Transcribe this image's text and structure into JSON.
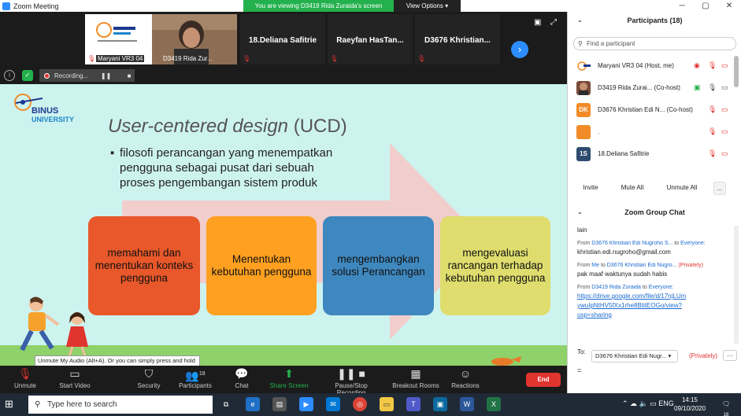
{
  "window": {
    "title": "Zoom Meeting",
    "controls": [
      "▭",
      "─",
      "▢",
      "✕"
    ]
  },
  "banner": {
    "viewing": "You are viewing D3419 Rida Zuraida's screen",
    "view_options": "View Options ▾"
  },
  "thumbnails": [
    {
      "name": "Maryani VR3 04"
    },
    {
      "name": "D3419 Rida Zur..."
    },
    {
      "name": "18.Deliana Safitrie"
    },
    {
      "name": "Raeyfan  HasTan..."
    },
    {
      "name": "D3676  Khristian..."
    }
  ],
  "recording": {
    "label": "Recording..."
  },
  "slide": {
    "logo_name": "BINUS",
    "logo_sub": "UNIVERSITY",
    "title_en": "User-centered design",
    "title_abbr": "(UCD)",
    "bullet_lines": [
      "filosofi perancangan yang menempatkan",
      "pengguna sebagai pusat dari sebuah",
      "proses pengembangan sistem produk"
    ],
    "cards": [
      {
        "text": "memahami dan menentukan konteks pengguna",
        "color": "#e8582a"
      },
      {
        "text": "Menentukan kebutuhan pengguna",
        "color": "#ffa020"
      },
      {
        "text": "mengembangkan solusi Perancangan",
        "color": "#3f88bf"
      },
      {
        "text": "mengevaluasi rancangan terhadap kebutuhan pengguna",
        "color": "#dedd6e"
      }
    ]
  },
  "tooltip": "Unmute My Audio (Alt+A). Or you can simply press and hold the space bar to temporarily unmute.",
  "toolbar": {
    "unmute": "Unmute",
    "start_video": "Start Video",
    "security": "Security",
    "participants": "Participants",
    "participants_count": "18",
    "chat": "Chat",
    "share_screen": "Share Screen",
    "pause_recording": "Pause/Stop Recording",
    "breakout_rooms": "Breakout Rooms",
    "reactions": "Reactions",
    "end": "End"
  },
  "participants_panel": {
    "title": "Participants (18)",
    "search_placeholder": "Find a participant",
    "rows": [
      {
        "initials": "",
        "name": "Maryani VR3 04 (Host, me)",
        "color": "#2d8cff"
      },
      {
        "initials": "",
        "name": "D3419 Rida Zurai... (Co-host)",
        "color": "#7a4b3a"
      },
      {
        "initials": "DK",
        "name": "D3676 Khristian Edi N... (Co-host)",
        "color": "#f28c28"
      },
      {
        "initials": "",
        "name": ".",
        "color": "#f28c28"
      },
      {
        "initials": "1S",
        "name": "18.Deliana Safitrie",
        "color": "#2f4b6e"
      }
    ],
    "invite": "Invite",
    "mute_all": "Mute All",
    "unmute_all": "Unmute All",
    "more": "..."
  },
  "chat": {
    "title": "Zoom Group Chat",
    "messages": [
      {
        "from": "",
        "to": "",
        "private": "",
        "text": "lain"
      },
      {
        "from": "D3676 Khristian Edi Nugroho S...",
        "to": "Everyone:",
        "private": "",
        "text": "khristian.edi.nugroho@gmail.com"
      },
      {
        "from": "Me",
        "to": "D3676 Khristian Edi Nugro...",
        "private": "(Privately)",
        "text": "pak maaf waktunya sudah habis"
      },
      {
        "from": "D3419 Rida Zuraida",
        "to": "Everyone:",
        "private": "",
        "text": ""
      }
    ],
    "link_lines": [
      "https://drive.google.com/file/d/17njLUm",
      "ywuIpNtHV5fXx1rhe8BtitEOGo/view?",
      "usp=sharing"
    ],
    "to_label": "To:",
    "to_value": "D3676 Khristian Edi Nugr... ▾",
    "to_private": "(Privately)",
    "input": "="
  },
  "taskbar": {
    "search_placeholder": "Type here to search",
    "time": "14:15",
    "date": "09/10/2020",
    "badge": "18"
  }
}
